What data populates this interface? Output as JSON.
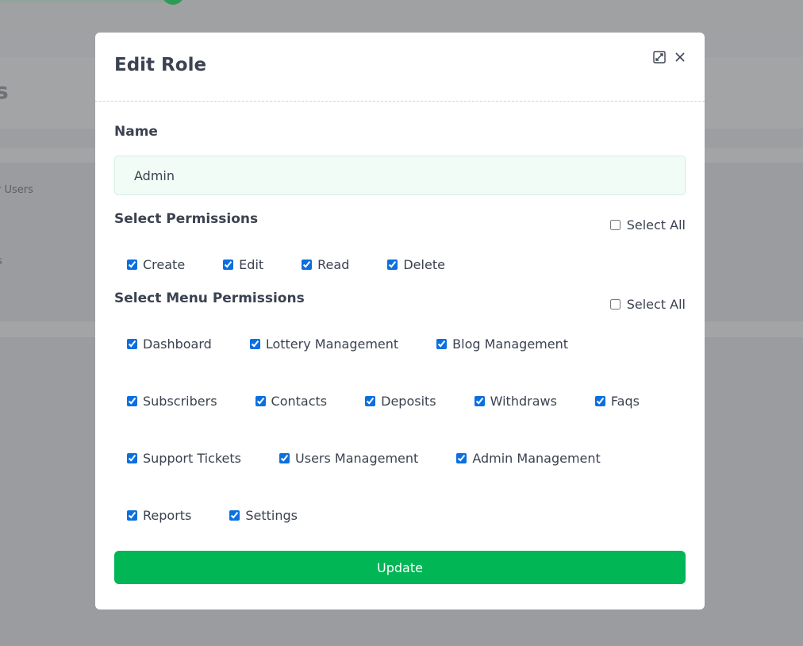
{
  "background": {
    "heading_fragment": "s",
    "card_text_1": "r Users",
    "card_text_2": "s"
  },
  "modal": {
    "title": "Edit Role",
    "expand_icon": "expand-icon",
    "close_icon": "close-icon",
    "name_label": "Name",
    "name_value": "Admin",
    "permissions": {
      "title": "Select Permissions",
      "select_all_label": "Select All",
      "select_all_checked": false,
      "items": [
        {
          "label": "Create",
          "checked": true
        },
        {
          "label": "Edit",
          "checked": true
        },
        {
          "label": "Read",
          "checked": true
        },
        {
          "label": "Delete",
          "checked": true
        }
      ]
    },
    "menu_permissions": {
      "title": "Select Menu Permissions",
      "select_all_label": "Select All",
      "select_all_checked": false,
      "rows": [
        [
          {
            "label": "Dashboard",
            "checked": true
          },
          {
            "label": "Lottery Management",
            "checked": true
          },
          {
            "label": "Blog Management",
            "checked": true
          }
        ],
        [
          {
            "label": "Subscribers",
            "checked": true
          },
          {
            "label": "Contacts",
            "checked": true
          },
          {
            "label": "Deposits",
            "checked": true
          },
          {
            "label": "Withdraws",
            "checked": true
          },
          {
            "label": "Faqs",
            "checked": true
          }
        ],
        [
          {
            "label": "Support Tickets",
            "checked": true
          },
          {
            "label": "Users Management",
            "checked": true
          },
          {
            "label": "Admin Management",
            "checked": true
          }
        ],
        [
          {
            "label": "Reports",
            "checked": true
          },
          {
            "label": "Settings",
            "checked": true
          }
        ]
      ]
    },
    "update_label": "Update"
  },
  "colors": {
    "accent": "#00b655",
    "checkbox": "#0b6fe0",
    "text": "#3b4250",
    "overlay": "#a3a4a6"
  }
}
